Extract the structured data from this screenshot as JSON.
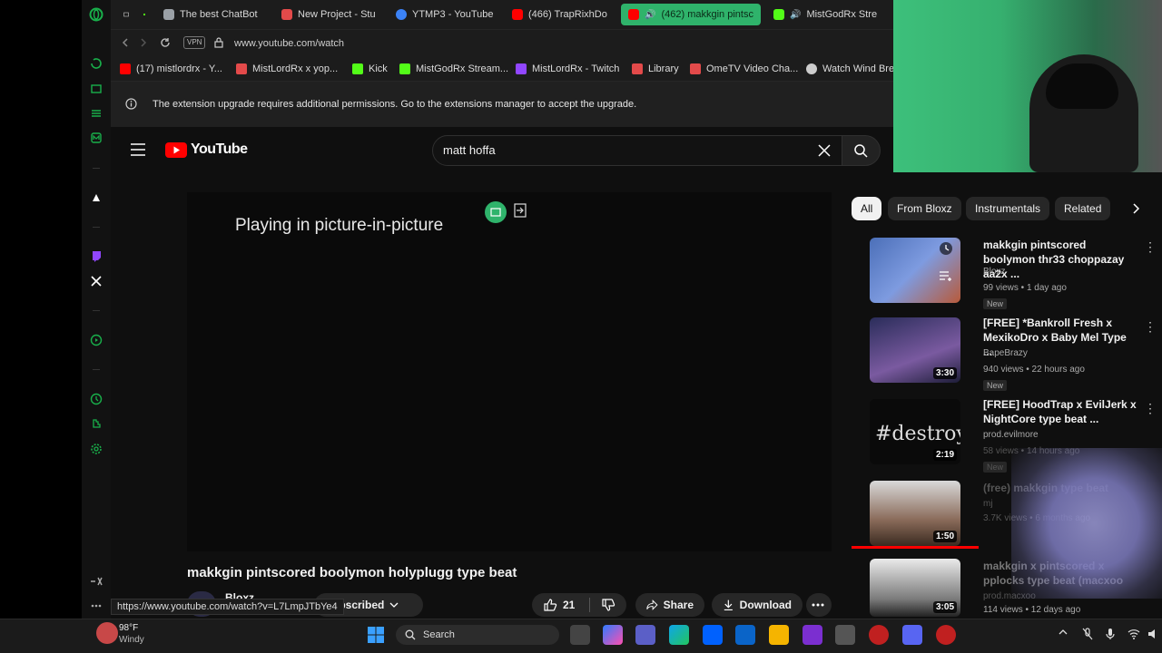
{
  "tabs": [
    {
      "label": "The best ChatBot",
      "color": "#9aa0a6"
    },
    {
      "label": "New Project - Stu",
      "color": "#e34a4a"
    },
    {
      "label": "YTMP3 - YouTube",
      "color": "#3b82f6"
    },
    {
      "label": "(466) TrapRixhDo",
      "color": "#ff0000"
    },
    {
      "label": "(462) makkgin pintsc",
      "color": "#ff0000"
    },
    {
      "label": "MistGodRx Stre",
      "color": "#53fc18"
    }
  ],
  "address": {
    "vpn_label": "VPN",
    "url": "www.youtube.com/watch"
  },
  "bookmarks": [
    {
      "label": "(17) mistlordrx - Y...",
      "color": "#ff0000"
    },
    {
      "label": "MistLordRx x yop...",
      "color": "#e34a4a"
    },
    {
      "label": "Kick",
      "color": "#53fc18"
    },
    {
      "label": "MistGodRx Stream...",
      "color": "#53fc18"
    },
    {
      "label": "MistLordRx - Twitch",
      "color": "#9146ff"
    },
    {
      "label": "Library",
      "color": "#e34a4a"
    },
    {
      "label": "OmeTV Video Cha...",
      "color": "#e34a4a"
    },
    {
      "label": "Watch Wind Brea",
      "color": "#cccccc"
    }
  ],
  "infobar": {
    "message": "The extension upgrade requires additional permissions. Go to the extensions manager to accept the upgrade."
  },
  "youtube": {
    "logo_text": "YouTube",
    "search_value": "matt hoffa",
    "pip_text": "Playing in picture-in-picture",
    "video_title": "makkgin pintscored boolymon holyplugg type beat",
    "channel_name": "Bloxz",
    "subscribed_label": "Subscribed",
    "likes": "21",
    "share_label": "Share",
    "download_label": "Download"
  },
  "chips": [
    "All",
    "From Bloxz",
    "Instrumentals",
    "Related"
  ],
  "recommendations": [
    {
      "title": "makkgin pintscored boolymon thr33 choppazay aa2x ...",
      "channel": "Bloxz",
      "meta": "99 views • 1 day ago",
      "badge": "New",
      "duration": ""
    },
    {
      "title": "[FREE] *Bankroll Fresh x MexikoDro x Baby Mel Type ...",
      "channel": "BapeBrazy",
      "meta": "940 views • 22 hours ago",
      "badge": "New",
      "duration": "3:30"
    },
    {
      "title": "[FREE] HoodTrap x EvilJerk x NightCore type beat ...",
      "channel": "prod.evilmore",
      "meta": "58 views • 14 hours ago",
      "badge": "New",
      "duration": "2:19"
    },
    {
      "title": "(free) makkgin type beat",
      "channel": "mj",
      "meta": "3.7K views • 6 months ago",
      "badge": "",
      "duration": "1:50"
    },
    {
      "title": "makkgin x pintscored x pplocks type beat (macxoo",
      "channel": "prod.macxoo",
      "meta": "114 views • 12 days ago",
      "badge": "",
      "duration": "3:05"
    }
  ],
  "status_url": "https://www.youtube.com/watch?v=L7LmpJTbYe4",
  "taskbar": {
    "weather_temp": "98°F",
    "weather_desc": "Windy",
    "search_label": "Search"
  },
  "colors": {
    "accent_green": "#2fb36b",
    "yt_red": "#ff0000",
    "bg": "#0f0f0f"
  }
}
